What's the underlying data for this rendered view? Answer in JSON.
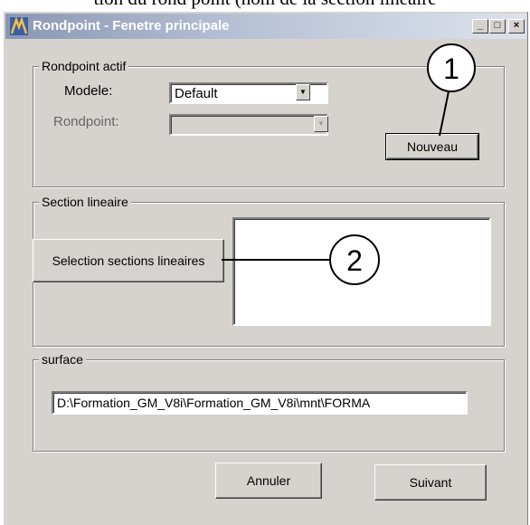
{
  "caption": "tion du rond point (nom de la section linéaire",
  "window": {
    "title": "Rondpoint - Fenetre principale",
    "controls": {
      "minimize": "_",
      "maximize": "□",
      "close": "×"
    }
  },
  "rondpoint_actif": {
    "legend": "Rondpoint actif",
    "modele_label": "Modele:",
    "modele_value": "Default",
    "rondpoint_label": "Rondpoint:",
    "rondpoint_value": "",
    "nouveau_button": "Nouveau"
  },
  "section_lineaire": {
    "legend": "Section lineaire",
    "selection_button": "Selection sections lineaires"
  },
  "surface": {
    "legend": "surface",
    "path_value": "D:\\Formation_GM_V8i\\Formation_GM_V8i\\mnt\\FORMA"
  },
  "footer": {
    "cancel_button": "Annuler",
    "next_button": "Suivant"
  },
  "annotations": {
    "callout_1": "1",
    "callout_2": "2"
  },
  "colors": {
    "dialog_bg": "#d6d3ce",
    "titlebar_start": "#8a97b3",
    "titlebar_end": "#dde2ec"
  }
}
